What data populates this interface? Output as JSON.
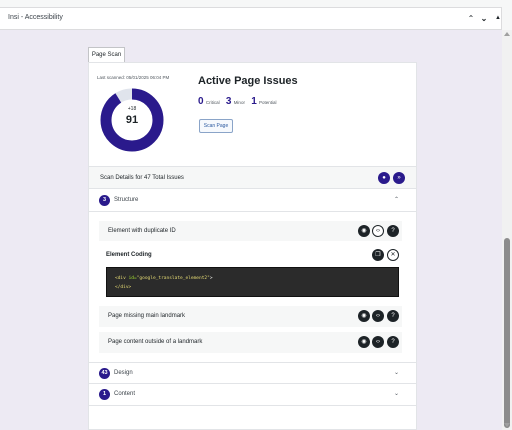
{
  "metabox": {
    "title": "Insi - Accessibility"
  },
  "tab": {
    "label": "Page Scan"
  },
  "summary": {
    "last_scanned": "Last scanned: 05/01/2025 06:04 PM",
    "score_delta": "+18",
    "score": "91",
    "score_fraction": 0.91,
    "heading": "Active Page Issues",
    "critical_count": "0",
    "critical_label": "Critical",
    "minor_count": "3",
    "minor_label": "Minor",
    "potential_count": "1",
    "potential_label": "Potential",
    "scan_button": "Scan Page"
  },
  "details": {
    "title": "Scan Details for 47 Total Issues"
  },
  "sections": [
    {
      "count": "3",
      "label": "Structure",
      "expanded": true
    },
    {
      "count": "43",
      "label": "Design",
      "expanded": false
    },
    {
      "count": "1",
      "label": "Content",
      "expanded": false
    }
  ],
  "issues": [
    {
      "label": "Element with duplicate ID"
    },
    {
      "label": "Page missing main landmark"
    },
    {
      "label": "Page content outside of a landmark"
    }
  ],
  "coding": {
    "title": "Element Coding",
    "open_tag": "<div",
    "attr": "id=",
    "value": "\"google_translate_element2\"",
    "close_bracket": ">",
    "end_tag": "</div>"
  },
  "colors": {
    "accent": "#2a1a8c",
    "gauge_track": "#e0e4ec"
  }
}
